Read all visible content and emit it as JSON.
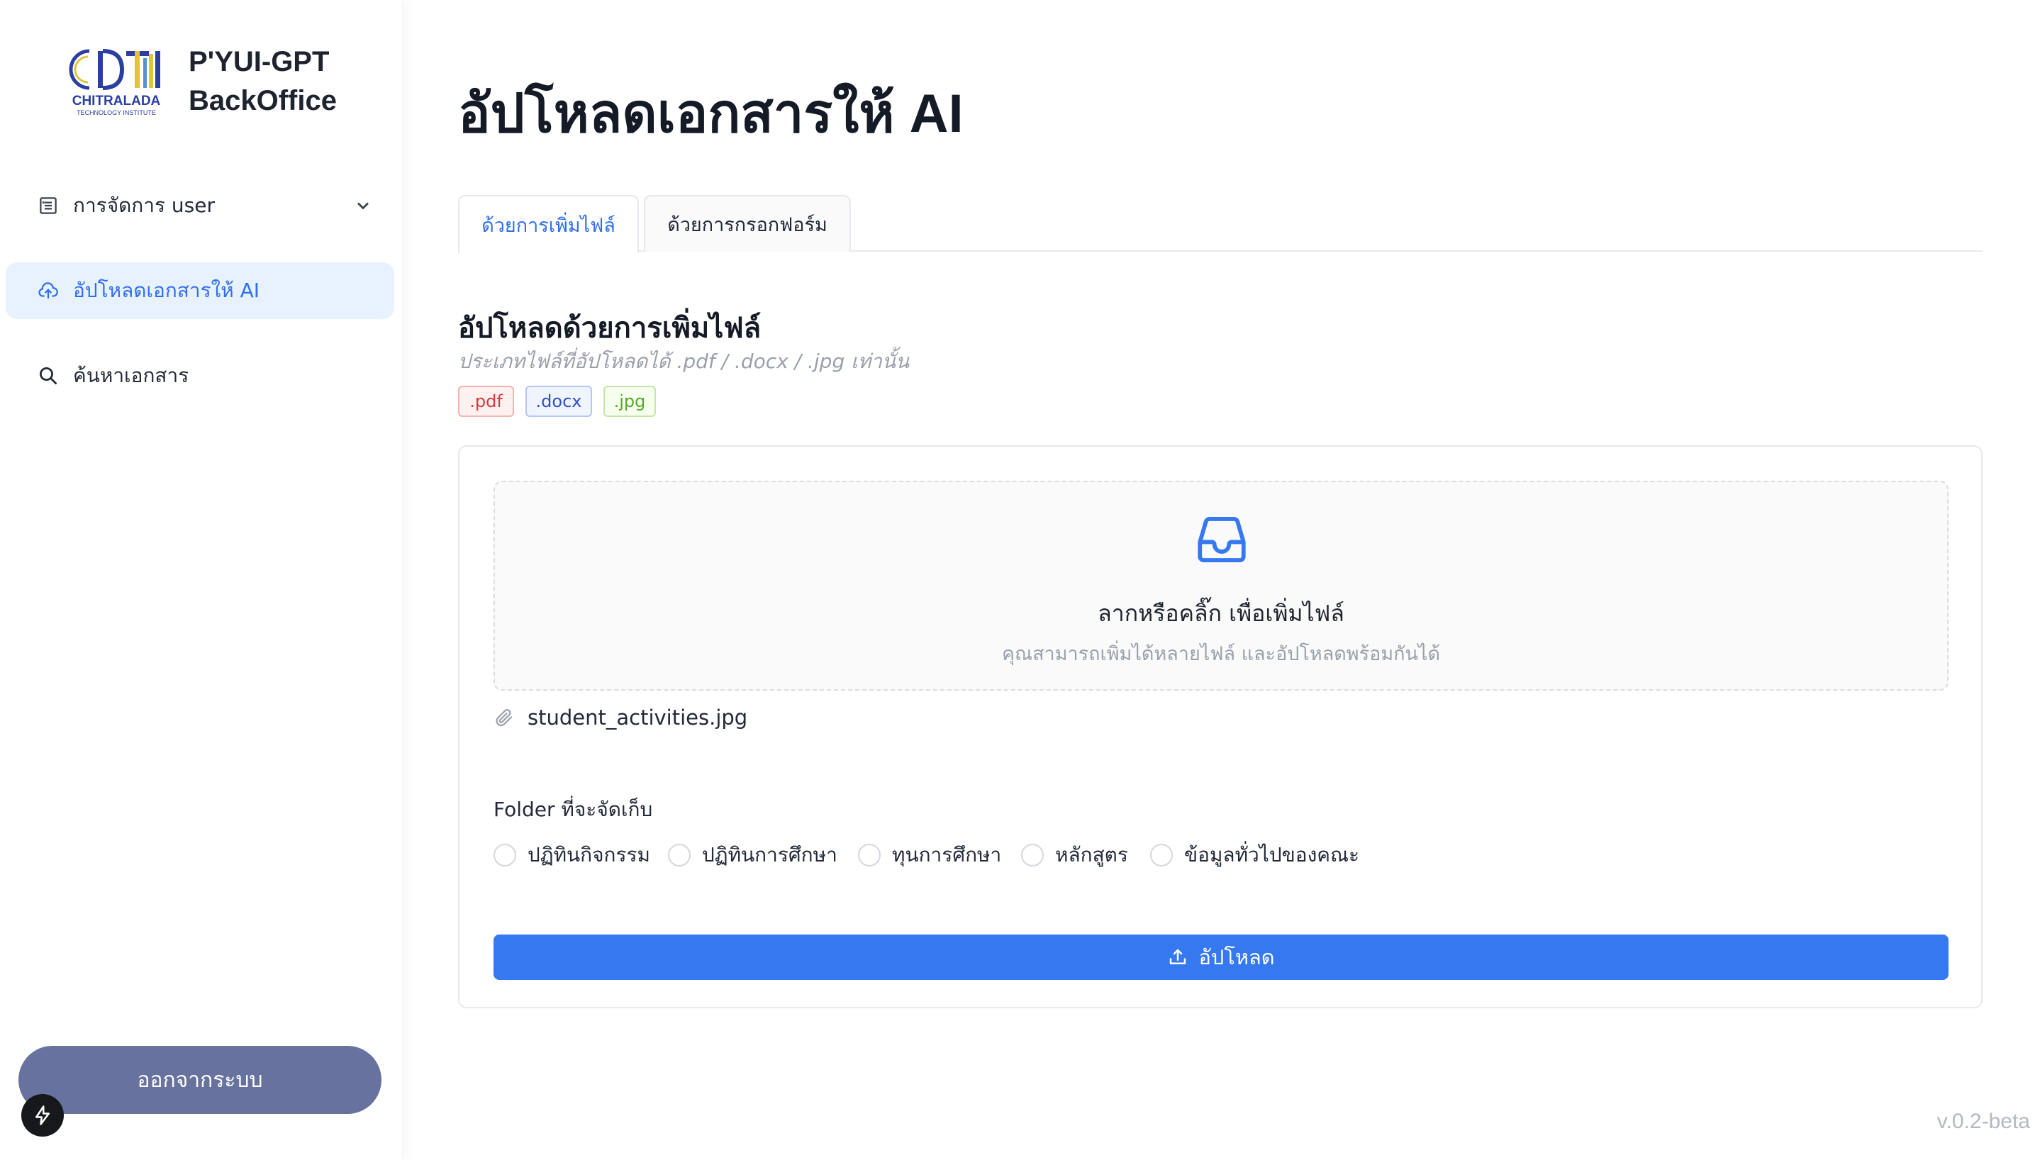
{
  "brand": {
    "logo_text": "CHITRALADA",
    "logo_subtext": "TECHNOLOGY INSTITUTE",
    "title_line1": "P'YUI-GPT",
    "title_line2": "BackOffice"
  },
  "sidebar": {
    "items": [
      {
        "label": "การจัดการ user",
        "icon": "list-icon",
        "expandable": true
      },
      {
        "label": "อัปโหลดเอกสารให้ AI",
        "icon": "cloud-upload-icon",
        "active": true
      },
      {
        "label": "ค้นหาเอกสาร",
        "icon": "search-icon"
      }
    ],
    "logout_label": "ออกจากระบบ"
  },
  "main": {
    "page_title": "อัปโหลดเอกสารให้ AI",
    "tabs": [
      {
        "label": "ด้วยการเพิ่มไฟล์",
        "active": true
      },
      {
        "label": "ด้วยการกรอกฟอร์ม",
        "active": false
      }
    ],
    "section_title": "อัปโหลดด้วยการเพิ่มไฟล์",
    "section_subtitle": "ประเภทไฟล์ที่อัปโหลดได้ .pdf / .docx / .jpg เท่านั้น",
    "file_types": [
      ".pdf",
      ".docx",
      ".jpg"
    ],
    "dropzone": {
      "icon": "inbox-icon",
      "title": "ลากหรือคลิ๊ก เพื่อเพิ่มไฟล์",
      "hint": "คุณสามารถเพิ่มได้หลายไฟล์ และอัปโหลดพร้อมกันได้"
    },
    "uploaded_file": "student_activities.jpg",
    "folder_label": "Folder ที่จะจัดเก็บ",
    "folder_options": [
      "ปฏิทินกิจกรรม",
      "ปฏิทินการศึกษา",
      "ทุนการศึกษา",
      "หลักสูตร",
      "ข้อมูลทั่วไปของคณะ"
    ],
    "upload_button": "อัปโหลด"
  },
  "version": "v.0.2-beta",
  "colors": {
    "accent": "#3678f0",
    "active_nav_bg": "#e7f1ff",
    "logout_bg": "#68729e"
  }
}
